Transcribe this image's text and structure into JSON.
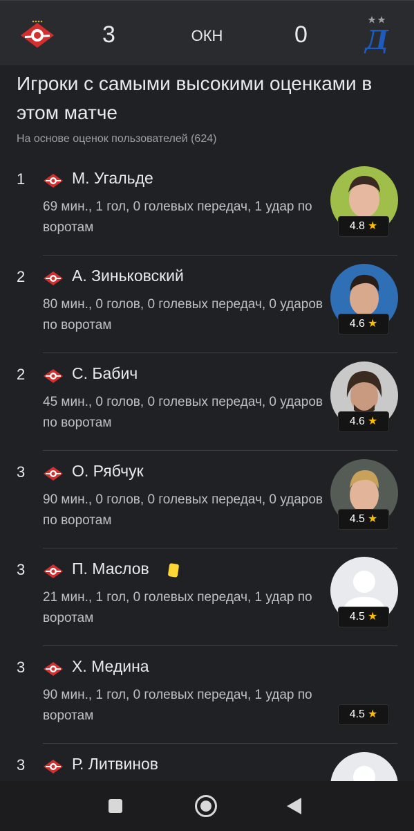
{
  "match": {
    "home_team_icon": "spartak-logo-icon",
    "away_team_icon": "dynamo-logo-icon",
    "home_score": "3",
    "away_score": "0",
    "status": "ОКН"
  },
  "section": {
    "title": "Игроки с самыми высокими оценками в этом матче",
    "subtitle": "На основе оценок пользователей (624)"
  },
  "players": [
    {
      "rank": "1",
      "name": "М. Угальде",
      "stats": "69 мин., 1 гол, 0 голевых передач, 1 удар по воротам",
      "rating": "4.8",
      "photo": "player-photo",
      "yellow_card": false
    },
    {
      "rank": "2",
      "name": "А. Зиньковский",
      "stats": "80 мин., 0 голов, 0 голевых передач, 0 ударов по воротам",
      "rating": "4.6",
      "photo": "player-photo",
      "yellow_card": false
    },
    {
      "rank": "2",
      "name": "С. Бабич",
      "stats": "45 мин., 0 голов, 0 голевых передач, 0 ударов по воротам",
      "rating": "4.6",
      "photo": "player-photo",
      "yellow_card": false
    },
    {
      "rank": "3",
      "name": "О. Рябчук",
      "stats": "90 мин., 0 голов, 0 голевых передач, 0 ударов по воротам",
      "rating": "4.5",
      "photo": "player-photo",
      "yellow_card": false
    },
    {
      "rank": "3",
      "name": "П. Маслов",
      "stats": "21 мин., 1 гол, 0 голевых передач, 1 удар по воротам",
      "rating": "4.5",
      "photo": "placeholder-avatar",
      "yellow_card": true
    },
    {
      "rank": "3",
      "name": "Х. Медина",
      "stats": "90 мин., 1 гол, 0 голевых передач, 1 удар по воротам",
      "rating": "4.5",
      "photo": "none",
      "yellow_card": false
    },
    {
      "rank": "3",
      "name": "Р. Литвинов",
      "stats": "",
      "rating": "",
      "photo": "placeholder-avatar",
      "yellow_card": false
    }
  ],
  "colors": {
    "background": "#202124",
    "header_bg": "#2a2b2e",
    "star": "#fbbc04",
    "spartak_red": "#d32f2f",
    "dynamo_blue": "#1e5bbf",
    "yellow_card": "#fdd835"
  },
  "nav": {
    "recents_icon": "square-icon",
    "home_icon": "circle-home-icon",
    "back_icon": "triangle-back-icon"
  }
}
